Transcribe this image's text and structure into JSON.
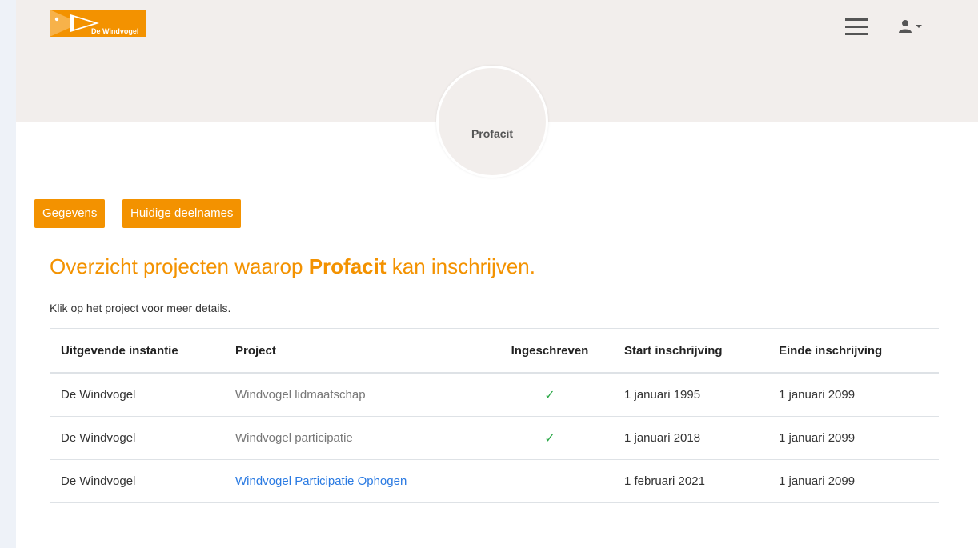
{
  "header": {
    "logo_text": "De Windvogel",
    "menu_icon": "hamburger-icon",
    "user_icon": "user-icon",
    "colors": {
      "header_bg": "#f2eeec",
      "accent": "#f39200"
    }
  },
  "profile": {
    "name": "Profacit"
  },
  "tabs": [
    {
      "label": "Gegevens"
    },
    {
      "label": "Huidige deelnames"
    }
  ],
  "main": {
    "heading_prefix": "Overzicht projecten waarop ",
    "heading_name": "Profacit",
    "heading_suffix": " kan inschrijven.",
    "hint": "Klik op het project voor meer details."
  },
  "table": {
    "headers": [
      "Uitgevende instantie",
      "Project",
      "Ingeschreven",
      "Start inschrijving",
      "Einde inschrijving"
    ],
    "rows": [
      {
        "issuer": "De Windvogel",
        "project": "Windvogel lidmaatschap",
        "enrolled": "✓",
        "start": "1 januari 1995",
        "end": "1 januari 2099"
      },
      {
        "issuer": "De Windvogel",
        "project": "Windvogel participatie",
        "enrolled": "✓",
        "start": "1 januari 2018",
        "end": "1 januari 2099"
      },
      {
        "issuer": "De Windvogel",
        "project": "Windvogel Participatie Ophogen",
        "enrolled": "",
        "start": "1 februari 2021",
        "end": "1 januari 2099"
      }
    ]
  }
}
